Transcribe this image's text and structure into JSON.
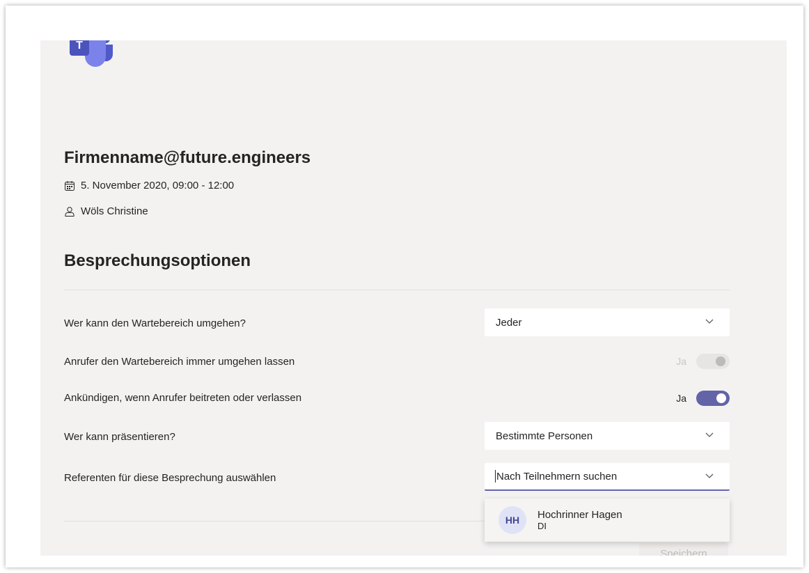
{
  "logo": {
    "tile_letter": "T"
  },
  "meeting": {
    "title": "Firmenname@future.engineers",
    "datetime": "5. November 2020, 09:00 - 12:00",
    "organizer": "Wöls Christine"
  },
  "options": {
    "section_title": "Besprechungsoptionen",
    "lobby_bypass": {
      "label": "Wer kann den Wartebereich umgehen?",
      "value": "Jeder"
    },
    "callers_bypass": {
      "label": "Anrufer den Wartebereich immer umgehen lassen",
      "toggle_text": "Ja",
      "enabled": false
    },
    "announce": {
      "label": "Ankündigen, wenn Anrufer beitreten oder verlassen",
      "toggle_text": "Ja",
      "enabled": true
    },
    "presenters": {
      "label": "Wer kann präsentieren?",
      "value": "Bestimmte Personen"
    },
    "select_presenters": {
      "label": "Referenten für diese Besprechung auswählen",
      "placeholder": "Nach Teilnehmern suchen"
    }
  },
  "suggestion": {
    "initials": "HH",
    "name": "Hochrinner Hagen",
    "subtitle": "DI"
  },
  "save_label": "Speichern",
  "colors": {
    "accent": "#6264a7",
    "panel_bg": "#f3f2f1"
  }
}
